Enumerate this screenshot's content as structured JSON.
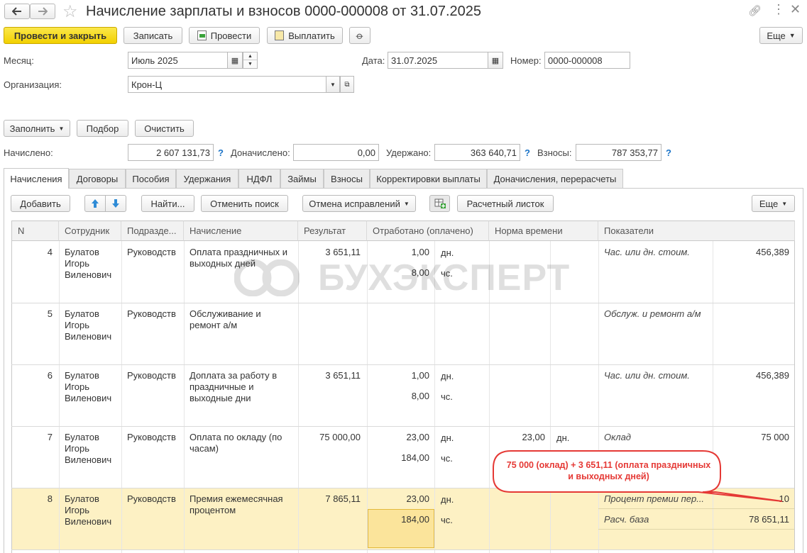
{
  "window": {
    "title": "Начисление зарплаты и взносов 0000-000008 от 31.07.2025"
  },
  "toolbar": {
    "post_close": "Провести и закрыть",
    "save": "Записать",
    "post": "Провести",
    "pay": "Выплатить",
    "more": "Еще"
  },
  "header": {
    "month_label": "Месяц:",
    "month_value": "Июль 2025",
    "date_label": "Дата:",
    "date_value": "31.07.2025",
    "number_label": "Номер:",
    "number_value": "0000-000008",
    "org_label": "Организация:",
    "org_value": "Крон-Ц"
  },
  "actions": {
    "fill": "Заполнить",
    "select": "Подбор",
    "clear": "Очистить"
  },
  "totals": {
    "accrued_label": "Начислено:",
    "accrued_value": "2 607 131,73",
    "extra_label": "Доначислено:",
    "extra_value": "0,00",
    "withheld_label": "Удержано:",
    "withheld_value": "363 640,71",
    "contrib_label": "Взносы:",
    "contrib_value": "787 353,77",
    "help": "?"
  },
  "tabs": [
    "Начисления",
    "Договоры",
    "Пособия",
    "Удержания",
    "НДФЛ",
    "Займы",
    "Взносы",
    "Корректировки выплаты",
    "Доначисления, перерасчеты"
  ],
  "grid_toolbar": {
    "add": "Добавить",
    "find": "Найти...",
    "cancel_search": "Отменить поиск",
    "cancel_fix": "Отмена исправлений",
    "payslip": "Расчетный листок",
    "more": "Еще"
  },
  "columns": [
    "N",
    "Сотрудник",
    "Подразде...",
    "Начисление",
    "Результат",
    "Отработано (оплачено)",
    "Норма времени",
    "Показатели"
  ],
  "rows": [
    {
      "n": "4",
      "employee": "Булатов Игорь Виленович",
      "dept": "Руководств",
      "accrual": "Оплата праздничных и выходных дней",
      "result": "3 651,11",
      "days": "1,00",
      "days_unit": "дн.",
      "hours": "8,00",
      "hours_unit": "чс.",
      "norm": "",
      "norm_unit": "",
      "ind1": "Час. или дн. стоим.",
      "ind1_val": "456,389",
      "ind2": "",
      "ind2_val": ""
    },
    {
      "n": "5",
      "employee": "Булатов Игорь Виленович",
      "dept": "Руководств",
      "accrual": "Обслуживание и ремонт а/м",
      "result": "",
      "days": "",
      "days_unit": "",
      "hours": "",
      "hours_unit": "",
      "norm": "",
      "norm_unit": "",
      "ind1": "Обслуж. и ремонт а/м",
      "ind1_val": "",
      "ind2": "",
      "ind2_val": ""
    },
    {
      "n": "6",
      "employee": "Булатов Игорь Виленович",
      "dept": "Руководств",
      "accrual": "Доплата за работу в праздничные и выходные дни",
      "result": "3 651,11",
      "days": "1,00",
      "days_unit": "дн.",
      "hours": "8,00",
      "hours_unit": "чс.",
      "norm": "",
      "norm_unit": "",
      "ind1": "Час. или дн. стоим.",
      "ind1_val": "456,389",
      "ind2": "",
      "ind2_val": ""
    },
    {
      "n": "7",
      "employee": "Булатов Игорь Виленович",
      "dept": "Руководств",
      "accrual": "Оплата по окладу (по часам)",
      "result": "75 000,00",
      "days": "23,00",
      "days_unit": "дн.",
      "hours": "184,00",
      "hours_unit": "чс.",
      "norm": "23,00",
      "norm_unit": "дн.",
      "ind1": "Оклад",
      "ind1_val": "75 000",
      "ind2": "",
      "ind2_val": ""
    },
    {
      "n": "8",
      "employee": "Булатов Игорь Виленович",
      "dept": "Руководств",
      "accrual": "Премия ежемесячная процентом",
      "result": "7 865,11",
      "days": "23,00",
      "days_unit": "дн.",
      "hours": "184,00",
      "hours_unit": "чс.",
      "norm": "",
      "norm_unit": "",
      "ind1": "Процент премии пер...",
      "ind1_val": "10",
      "ind2": "Расч. база",
      "ind2_val": "78 651,11"
    }
  ],
  "callout": "75 000 (оклад) + 3 651,11 (оплата праздничных и выходных дней)",
  "watermark": "БУХЭКСПЕРТ",
  "colors": {
    "primary_button": "#f5d800",
    "selected_row": "#fdf1c4",
    "callout": "#e53935",
    "help": "#1a73c7"
  }
}
